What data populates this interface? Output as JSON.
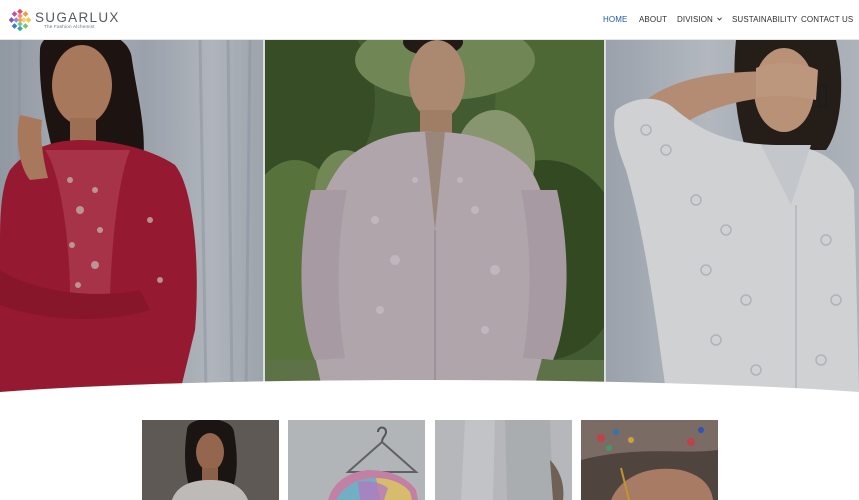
{
  "brand": {
    "name": "SUGARLUX",
    "tagline": "The Fashion Alchemist",
    "logo_icon": "mosaic-flower-logo"
  },
  "nav": {
    "items": [
      {
        "label": "HOME",
        "active": true
      },
      {
        "label": "ABOUT",
        "active": false
      },
      {
        "label": "DIVISION",
        "active": false,
        "has_dropdown": true,
        "icon": "chevron-down-icon"
      },
      {
        "label": "SUSTAINABILITY",
        "active": false
      },
      {
        "label": "CONTACT US",
        "active": false
      }
    ]
  },
  "colors": {
    "nav_active": "#1f5aa6",
    "nav_text": "#2f2f2f",
    "header_bg": "#ffffff",
    "hero_overlay": "#00000026"
  },
  "hero": {
    "panels": [
      {
        "garment": "red embroidered kurta",
        "color": "#b51f3b"
      },
      {
        "garment": "lilac chikankari tunic",
        "color": "#c9b9c2"
      },
      {
        "garment": "white eyelet shirt",
        "color": "#eceef0"
      }
    ]
  },
  "cards": [
    {
      "subject": "model in white kurta"
    },
    {
      "subject": "tie-dye garment on hanger"
    },
    {
      "subject": "white fabric detail"
    },
    {
      "subject": "hand embroidery craft"
    }
  ]
}
